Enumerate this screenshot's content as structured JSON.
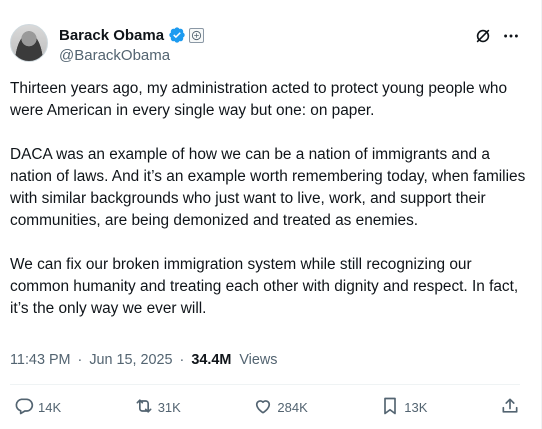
{
  "author": {
    "display_name": "Barack Obama",
    "handle": "@BarackObama",
    "verified_color": "#1d9bf0"
  },
  "body": {
    "paragraphs": [
      "Thirteen years ago, my administration acted to protect young people who were American in every single way but one: on paper.",
      "DACA was an example of how we can be a nation of immigrants and a nation of laws. And it’s an example worth remembering today, when families with similar backgrounds who just want to live, work, and support their communities, are being demonized and treated as enemies.",
      "We can fix our broken immigration system while still recognizing our common humanity and treating each other with dignity and respect. In fact, it’s the only way we ever will."
    ]
  },
  "meta": {
    "time": "11:43 PM",
    "separator": "·",
    "date": "Jun 15, 2025",
    "views_count": "34.4M",
    "views_label": "Views"
  },
  "actions": {
    "replies": "14K",
    "reposts": "31K",
    "likes": "284K",
    "bookmarks": "13K"
  },
  "icons": [
    "grok-icon",
    "more-icon",
    "reply-icon",
    "repost-icon",
    "like-icon",
    "bookmark-icon",
    "share-icon",
    "verified-badge-icon",
    "government-badge-icon"
  ]
}
